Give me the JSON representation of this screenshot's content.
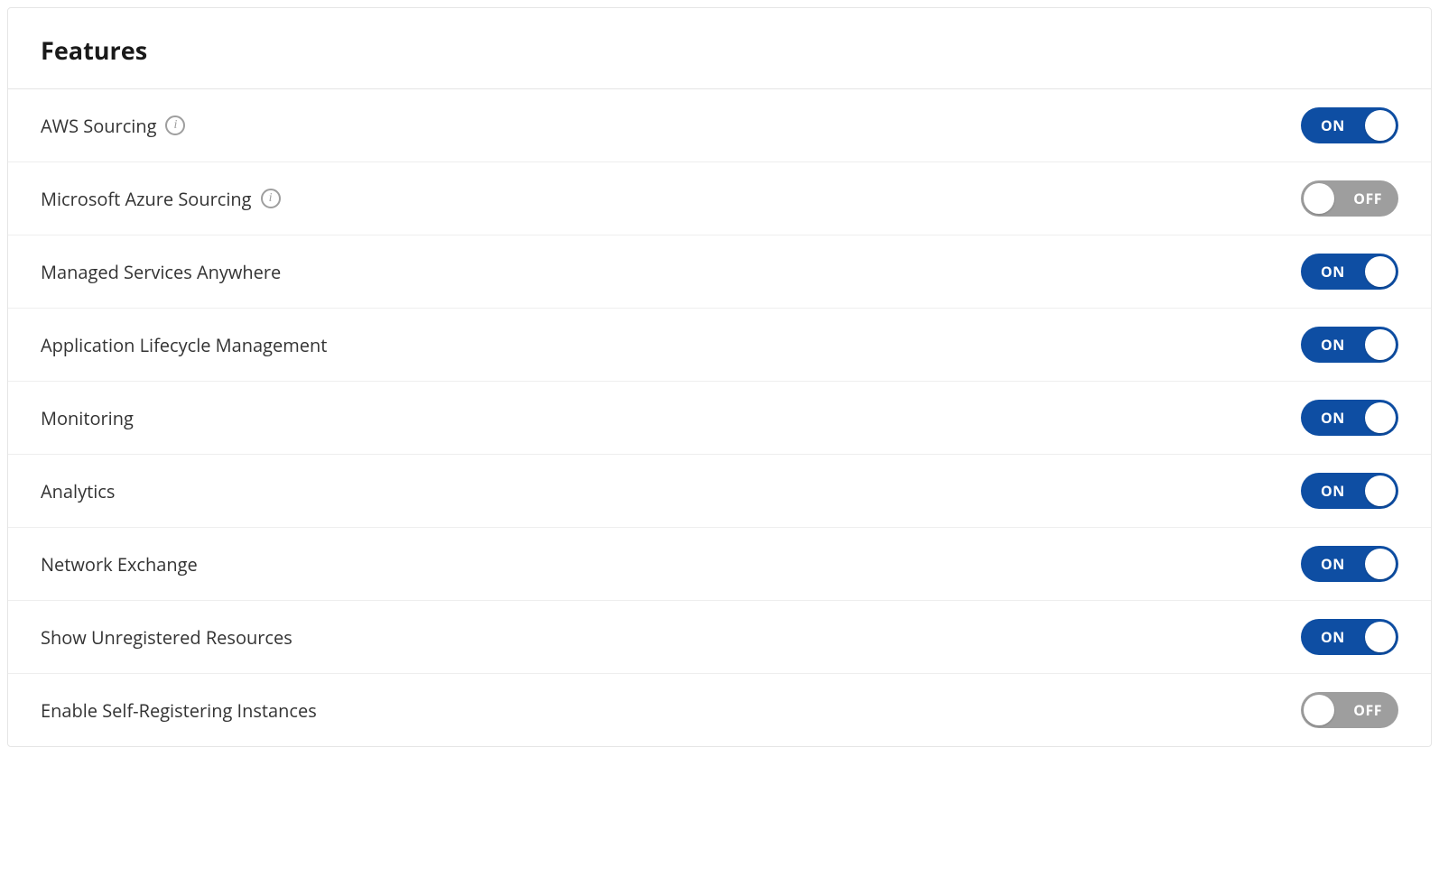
{
  "panel": {
    "title": "Features"
  },
  "toggle_labels": {
    "on": "ON",
    "off": "OFF"
  },
  "features": [
    {
      "label": "AWS Sourcing",
      "info": true,
      "state": "on"
    },
    {
      "label": "Microsoft Azure Sourcing",
      "info": true,
      "state": "off"
    },
    {
      "label": "Managed Services Anywhere",
      "info": false,
      "state": "on"
    },
    {
      "label": "Application Lifecycle Management",
      "info": false,
      "state": "on"
    },
    {
      "label": "Monitoring",
      "info": false,
      "state": "on"
    },
    {
      "label": "Analytics",
      "info": false,
      "state": "on"
    },
    {
      "label": "Network Exchange",
      "info": false,
      "state": "on"
    },
    {
      "label": "Show Unregistered Resources",
      "info": false,
      "state": "on"
    },
    {
      "label": "Enable Self-Registering Instances",
      "info": false,
      "state": "off"
    }
  ]
}
